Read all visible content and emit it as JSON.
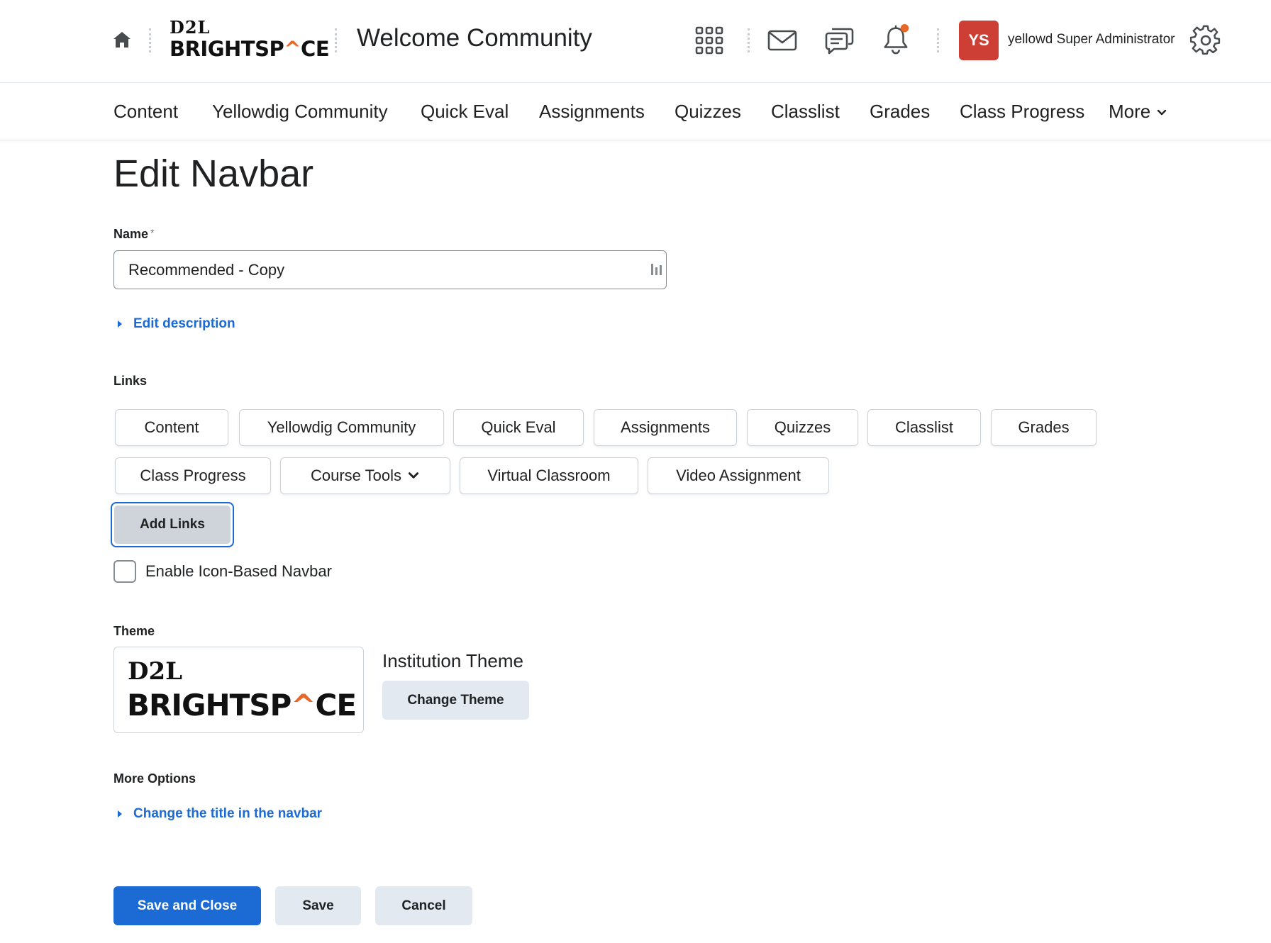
{
  "header": {
    "logo_top": "D2L",
    "logo_bottom_pre": "BRIGHTSP",
    "logo_bottom_accent": "^",
    "logo_bottom_post": "CE",
    "course_title": "Welcome Community",
    "avatar_initials": "YS",
    "avatar_color": "#cd3f35",
    "username": "yellowd Super Administrator",
    "icons": [
      "home-icon",
      "grid-icon",
      "mail-icon",
      "chat-icon",
      "bell-icon",
      "gear-icon"
    ],
    "notification_dot_color": "#e8682a"
  },
  "navbar": {
    "items": [
      "Content",
      "Yellowdig Community",
      "Quick Eval",
      "Assignments",
      "Quizzes",
      "Classlist",
      "Grades",
      "Class Progress"
    ],
    "more_label": "More"
  },
  "page": {
    "title": "Edit Navbar",
    "name_label": "Name",
    "name_required": "*",
    "name_value": "Recommended - Copy",
    "edit_description": "Edit description",
    "links_label": "Links",
    "links": [
      "Content",
      "Yellowdig Community",
      "Quick Eval",
      "Assignments",
      "Quizzes",
      "Classlist",
      "Grades",
      "Class Progress",
      "Course Tools",
      "Virtual Classroom",
      "Video Assignment"
    ],
    "add_links": "Add Links",
    "icon_navbar_label": "Enable Icon-Based Navbar",
    "icon_navbar_checked": false,
    "theme_label": "Theme",
    "theme_name": "Institution Theme",
    "change_theme": "Change Theme",
    "more_options_label": "More Options",
    "change_title": "Change the title in the navbar"
  },
  "footer": {
    "save_close": "Save and Close",
    "save": "Save",
    "cancel": "Cancel"
  },
  "colors": {
    "primary": "#1c6ad3",
    "link": "#1c6ad3",
    "accent": "#e8682a"
  }
}
